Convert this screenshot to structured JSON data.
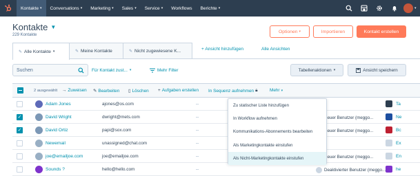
{
  "nav": {
    "items": [
      {
        "label": "Kontakte",
        "caret": true,
        "active": true
      },
      {
        "label": "Conversations",
        "caret": true
      },
      {
        "label": "Marketing",
        "caret": true
      },
      {
        "label": "Sales",
        "caret": true
      },
      {
        "label": "Service",
        "caret": true
      },
      {
        "label": "Workflows",
        "caret": false
      },
      {
        "label": "Berichte",
        "caret": true
      }
    ],
    "icons": [
      "search-icon",
      "marketplace-icon",
      "settings-icon",
      "notifications-icon",
      "account-avatar"
    ],
    "brand_color": "#2d3e50",
    "active_color": "#425b76"
  },
  "header": {
    "title": "Kontakte",
    "count": "229 Kontakte",
    "options_label": "Optionen",
    "import_label": "Importieren",
    "create_label": "Kontakt erstellen",
    "accent": "#ff7a59"
  },
  "tabs": [
    {
      "label": "Alle Kontakte",
      "active": true
    },
    {
      "label": "Meine Kontakte",
      "active": false
    },
    {
      "label": "Nicht zugewiesene K...",
      "active": false
    }
  ],
  "add_view_label": "+ Ansicht hinzufügen",
  "all_views_label": "Alle Ansichten",
  "filters": {
    "search_placeholder": "Suchen",
    "contact_owner": "Für Kontakt zust...",
    "more_filters": "Mehr Filter",
    "table_actions": "Tabellenaktionen",
    "save_view": "Ansicht speichern"
  },
  "bulk_actions": {
    "selected_count": "2 ausgewählt",
    "assign": "Zuweisen",
    "edit": "Bearbeiten",
    "delete": "Löschen",
    "create_tasks": "Aufgaben erstellen",
    "enroll_sequence": "In Sequenz aufnehmen",
    "more": "Mehr"
  },
  "rows": [
    {
      "name": "Adam Jones",
      "email": "ajones@os.com",
      "dash": "--",
      "owner": "",
      "company": "Ta",
      "checked": false,
      "avatar_color": "#5e6ab8",
      "logo_color": "#2d3e50"
    },
    {
      "name": "David Wright",
      "email": "dwright@mets.com",
      "dash": "--",
      "owner": "Neuer Benutzer (meggo...",
      "company": "Ne",
      "checked": true,
      "avatar_color": "#7c98b6",
      "logo_color": "#1d4fa0"
    },
    {
      "name": "David Ortiz",
      "email": "papi@sox.com",
      "dash": "--",
      "owner": "Neuer Benutzer (meggo...",
      "company": "Bc",
      "checked": true,
      "avatar_color": "#7c98b6",
      "logo_color": "#bd2031"
    },
    {
      "name": "Newemail",
      "email": "unassigned@chat.com",
      "dash": "--",
      "owner": "",
      "company": "Ex",
      "checked": false,
      "avatar_color": "#99afc4",
      "logo_color": "#cbd6e2"
    },
    {
      "name": "joe@emailjoe.com",
      "email": "joe@emailjoe.com",
      "dash": "--",
      "owner": "Neuer Benutzer (meggo...",
      "company": "En",
      "checked": false,
      "avatar_color": "#99afc4",
      "logo_color": "#cbd6e2"
    },
    {
      "name": "Sounds ?",
      "email": "hello@hello.com",
      "dash": "--",
      "owner": "Deaktivierter Benutzer (meggo...",
      "company": "he",
      "checked": false,
      "avatar_color": "#7e33cc",
      "logo_color": "#7e33cc"
    }
  ],
  "more_menu": [
    "Zu statischer Liste hinzufügen",
    "In Workflow aufnehmen",
    "Kommunikations-Abonnements bearbeiten",
    "Als Marketingkontakte einstufen",
    "Als Nicht-Marketingkontakte einstufen"
  ],
  "more_menu_highlighted": 4,
  "link_color": "#0091ae"
}
